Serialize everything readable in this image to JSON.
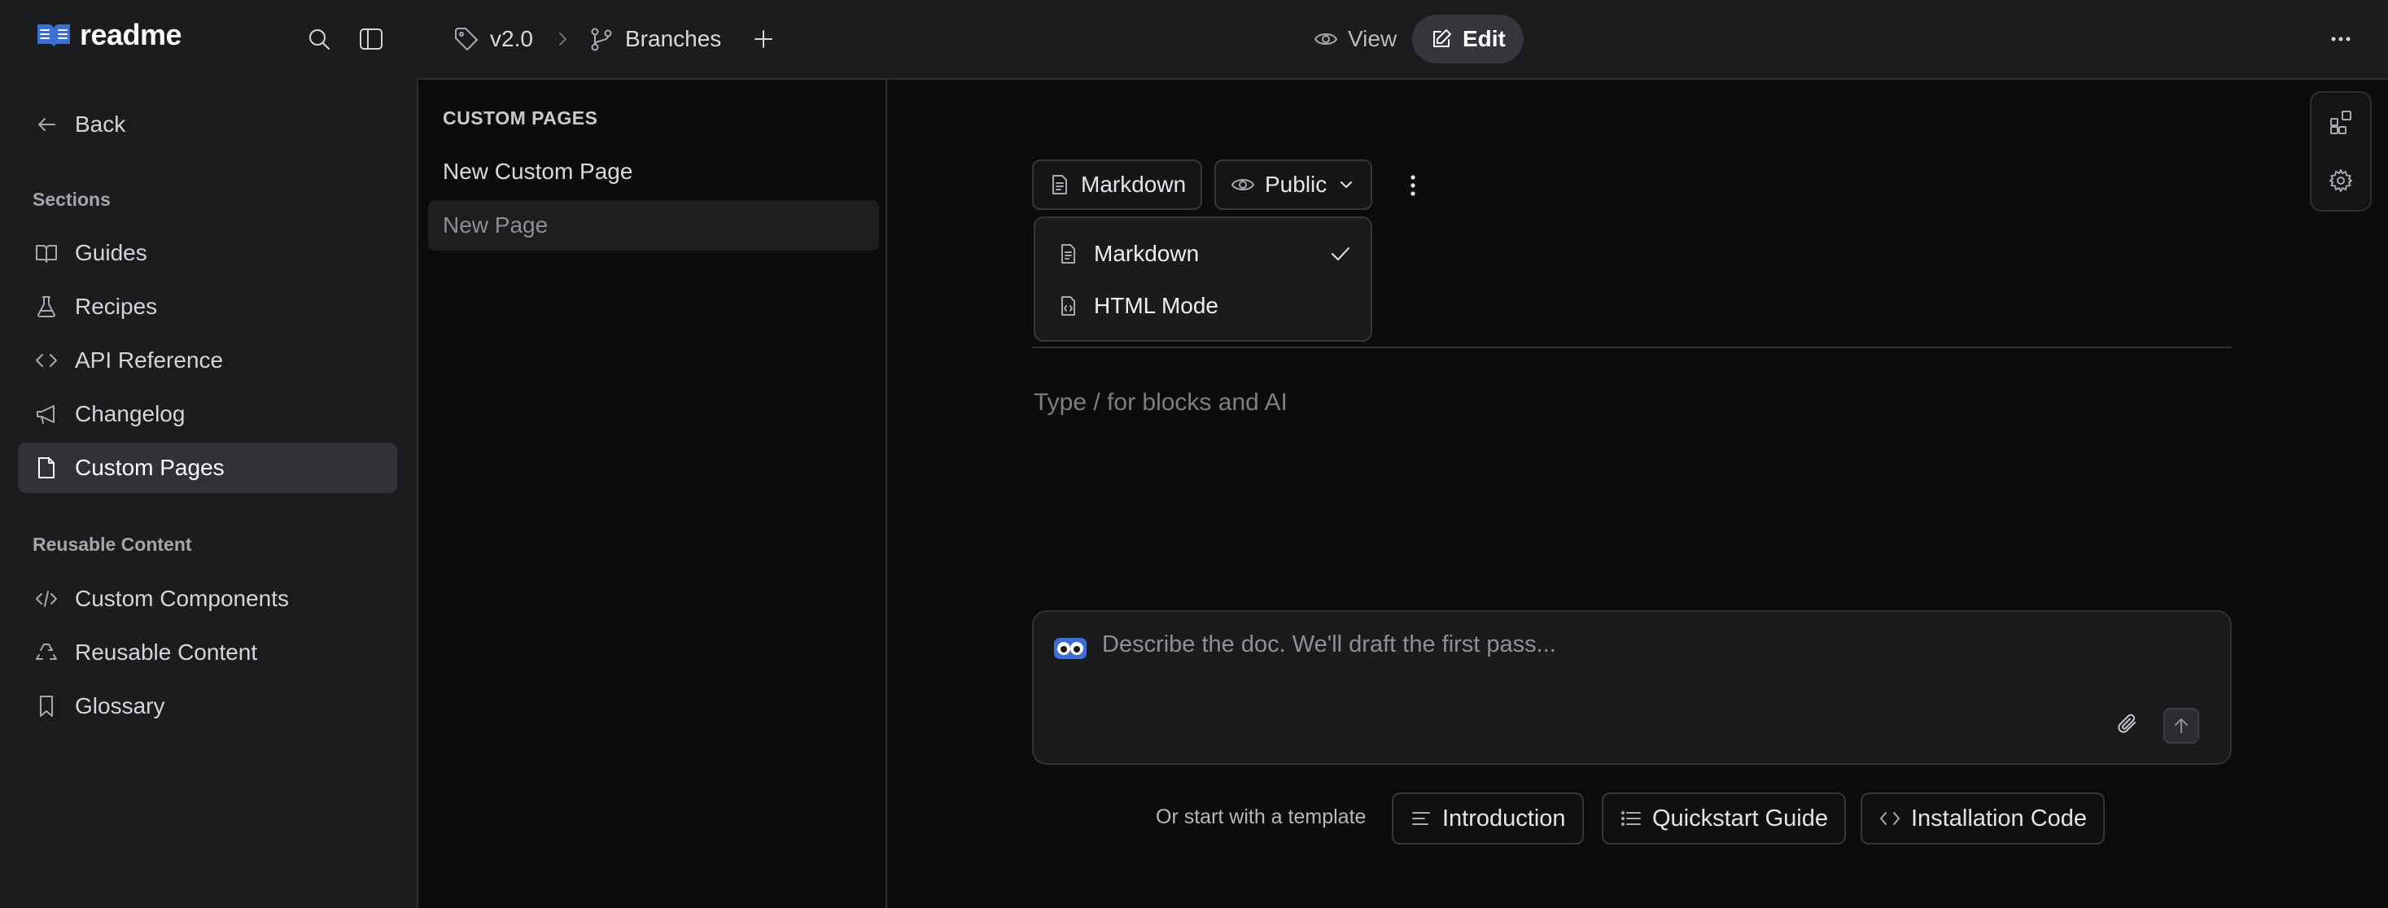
{
  "brand": {
    "name": "readme"
  },
  "topbar": {
    "version": "v2.0",
    "branches": "Branches",
    "view_label": "View",
    "edit_label": "Edit"
  },
  "sidebar": {
    "back_label": "Back",
    "sections_heading": "Sections",
    "sections": [
      {
        "label": "Guides",
        "icon": "book-icon"
      },
      {
        "label": "Recipes",
        "icon": "flask-icon"
      },
      {
        "label": "API Reference",
        "icon": "code-icon"
      },
      {
        "label": "Changelog",
        "icon": "megaphone-icon"
      },
      {
        "label": "Custom Pages",
        "icon": "file-icon",
        "active": true
      }
    ],
    "reusable_heading": "Reusable Content",
    "reusable": [
      {
        "label": "Custom Components",
        "icon": "code-slash-icon"
      },
      {
        "label": "Reusable Content",
        "icon": "recycle-icon"
      },
      {
        "label": "Glossary",
        "icon": "bookmark-icon"
      }
    ]
  },
  "pages": {
    "heading": "CUSTOM PAGES",
    "items": [
      "New Custom Page",
      "New Page"
    ]
  },
  "editor": {
    "format_label": "Markdown",
    "visibility_label": "Public",
    "format_menu": {
      "options": [
        "Markdown",
        "HTML Mode"
      ],
      "selected": "Markdown"
    },
    "body_placeholder": "Type / for blocks and AI",
    "ai_placeholder": "Describe the doc. We'll draft the first pass...",
    "template_prompt": "Or start with a template",
    "templates": [
      "Introduction",
      "Quickstart Guide",
      "Installation Code"
    ]
  },
  "colors": {
    "brand_blue": "#3b6fd8",
    "active_bg": "#303236",
    "canvas": "#0b0c0c"
  }
}
